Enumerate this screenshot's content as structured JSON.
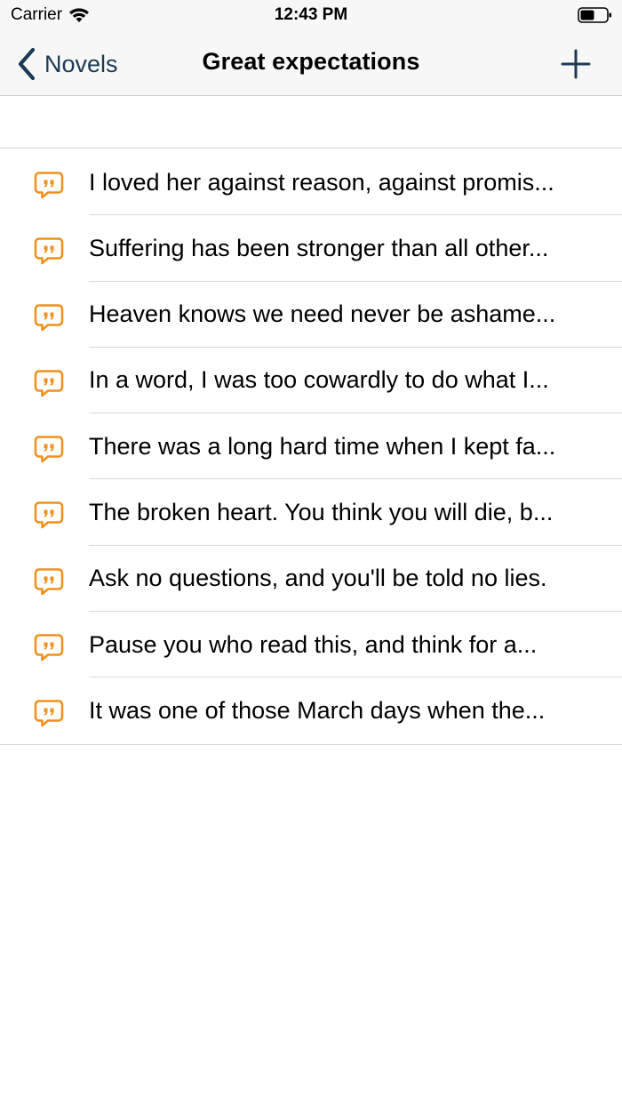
{
  "status_bar": {
    "carrier": "Carrier",
    "time": "12:43 PM"
  },
  "nav": {
    "back_label": "Novels",
    "title": "Great expectations",
    "accent_color": "#1b3a57"
  },
  "quote_icon_color": "#f0901e",
  "quotes": [
    {
      "text": "I loved her against reason, against promis..."
    },
    {
      "text": "Suffering has been stronger than all other..."
    },
    {
      "text": "Heaven knows we need never be ashame..."
    },
    {
      "text": "In a word, I was too cowardly to do what I..."
    },
    {
      "text": "There was a long hard time when I kept fa..."
    },
    {
      "text": "The broken heart. You think you will die, b..."
    },
    {
      "text": "Ask no questions, and you'll be told no lies."
    },
    {
      "text": "Pause you who read this, and think for a..."
    },
    {
      "text": "It was one of those March days when the..."
    }
  ]
}
